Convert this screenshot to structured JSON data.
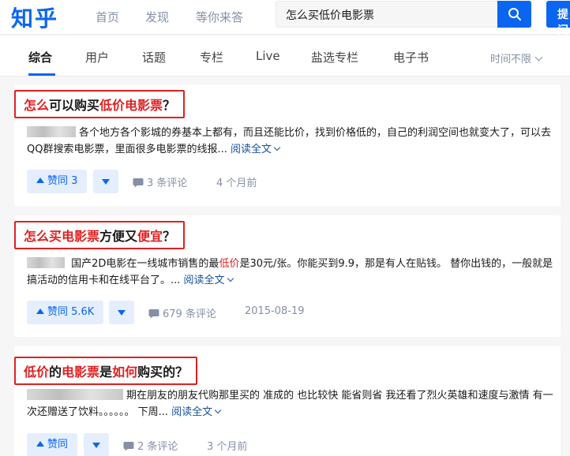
{
  "header": {
    "logo": "知乎",
    "nav": [
      "首页",
      "发现",
      "等你来答"
    ],
    "search_value": "怎么买低价电影票",
    "ask_label": "提问"
  },
  "tabs": {
    "items": [
      "综合",
      "用户",
      "话题",
      "专栏",
      "Live",
      "盐选专栏",
      "电子书"
    ],
    "active": "综合",
    "time_filter": "时间不限"
  },
  "results": [
    {
      "title": [
        {
          "text": "怎么",
          "hl": true
        },
        {
          "text": "可以购买",
          "hl": false
        },
        {
          "text": "低价电影票",
          "hl": true
        },
        {
          "text": "？",
          "hl": false
        }
      ],
      "excerpt": [
        {
          "text": "各个地方各个影城的券基本上都有，而且还能比价，找到价格低的，自己的利润空间也就变大了，可以去QQ群搜索电影票，里面很多电影票的线报... ",
          "em": false
        }
      ],
      "read_more": "阅读全文",
      "vote": "赞同 3",
      "comments": "3 条评论",
      "time": "4 个月前"
    },
    {
      "title": [
        {
          "text": "怎么买电影票",
          "hl": true
        },
        {
          "text": "方便又",
          "hl": false
        },
        {
          "text": "便宜",
          "hl": true
        },
        {
          "text": "？",
          "hl": false
        }
      ],
      "excerpt": [
        {
          "text": "国产2D电影在一线城市销售的最",
          "em": false
        },
        {
          "text": "低价",
          "em": true
        },
        {
          "text": "是30元/张。你能买到9.9，那是有人在贴钱。 替你出钱的，一般就是搞活动的信用卡和在线平台了。... ",
          "em": false
        }
      ],
      "read_more": "阅读全文",
      "vote": "赞同 5.6K",
      "comments": "679 条评论",
      "time": "2015-08-19"
    },
    {
      "title": [
        {
          "text": "低价",
          "hl": true
        },
        {
          "text": "的",
          "hl": false
        },
        {
          "text": "电影票",
          "hl": true
        },
        {
          "text": "是",
          "hl": false
        },
        {
          "text": "如何",
          "hl": true
        },
        {
          "text": "购买的？",
          "hl": false
        }
      ],
      "excerpt": [
        {
          "text": "期在朋友的朋友代购那里买的 准成的 也比较快 能省则省 我还看了烈火英雄和速度与激情 有一次还赠送了饮料。。。。。。 下周... ",
          "em": false
        }
      ],
      "read_more": "阅读全文",
      "vote": "赞同",
      "comments": "2 条评论",
      "time": "3 个月前"
    }
  ],
  "icons": {
    "search": "search-icon",
    "comment": "comment-icon",
    "vote_up": "triangle-up-icon",
    "vote_down": "triangle-down-icon",
    "chevron": "chevron-down-icon"
  },
  "colors": {
    "brand": "#0a66f0",
    "highlight": "#e02020",
    "link": "#175199",
    "muted": "#8590a6"
  }
}
